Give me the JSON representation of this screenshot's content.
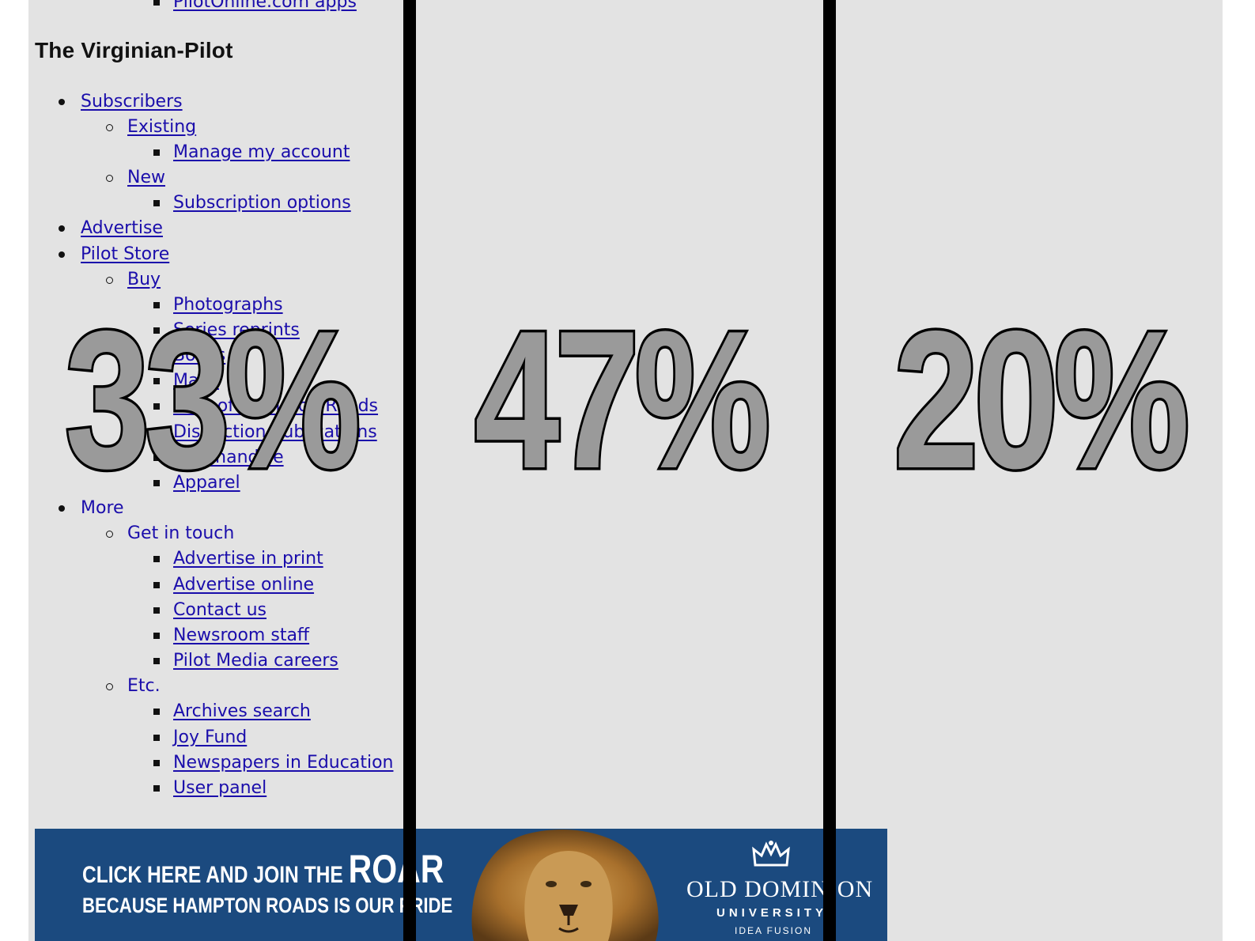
{
  "site_title": "The Virginian-Pilot",
  "nav": {
    "apps": "PilotOnline.com apps",
    "subscribers": "Subscribers",
    "existing": "Existing",
    "manage_account": "Manage my account",
    "new": "New",
    "subscription_options": "Subscription options",
    "advertise": "Advertise",
    "pilot_store": "Pilot Store",
    "buy": "Buy",
    "photographs": "Photographs",
    "series_reprints": "Series reprints",
    "books": "Books",
    "maps": "Maps",
    "best_of_hampton_roads": "Best of Hampton Roads",
    "distinction_publications": "Distinction publications",
    "merchandise": "Merchandise",
    "apparel": "Apparel",
    "more": "More",
    "get_in_touch": "Get in touch",
    "advertise_in_print": "Advertise in print",
    "advertise_online": "Advertise online",
    "contact_us": "Contact us",
    "newsroom_staff": "Newsroom staff",
    "pilot_media_careers": "Pilot Media careers",
    "etc": "Etc.",
    "archives_search": "Archives search",
    "joy_fund": "Joy Fund",
    "newspapers_in_education": "Newspapers in Education",
    "user_panel": "User panel"
  },
  "percent_overlay": {
    "left": "33%",
    "middle": "47%",
    "right": "20%"
  },
  "ad": {
    "line1_prefix": "CLICK HERE AND JOIN THE",
    "line1_big": "ROAR",
    "line2": "BECAUSE HAMPTON ROADS IS OUR PRIDE",
    "brand_name": "OLD DOMINION",
    "brand_sub": "UNIVERSITY",
    "tagline": "IDEA FUSION"
  },
  "colors": {
    "page_bg": "#e3e3e3",
    "link": "#1a0dab",
    "ad_bg": "#1b4a7f",
    "overlay_fill": "#9a9a9a"
  }
}
